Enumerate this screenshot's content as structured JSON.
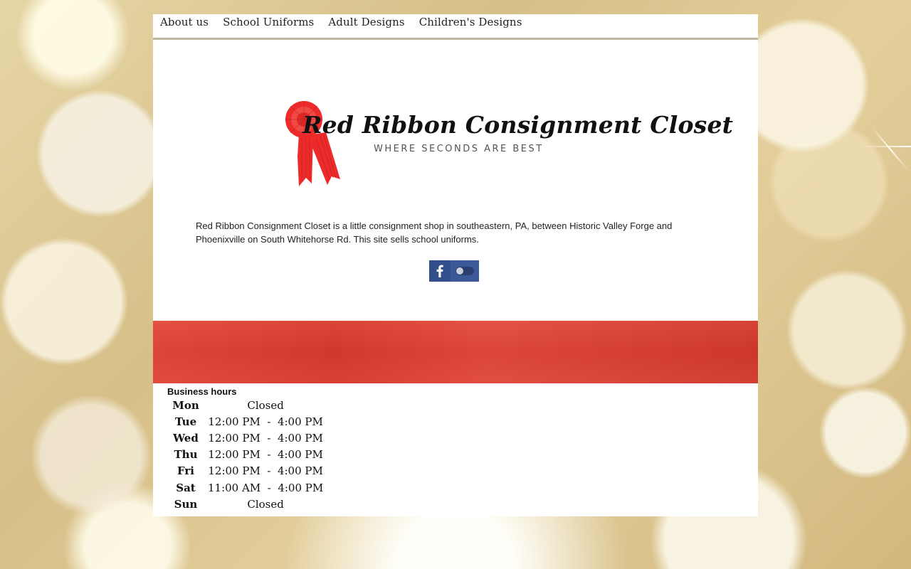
{
  "nav": {
    "items": [
      "About us",
      "School Uniforms",
      "Adult Designs",
      "Children's Designs"
    ]
  },
  "logo": {
    "title": "Red Ribbon Consignment Closet",
    "tagline": "WHERE SECONDS ARE BEST",
    "ribbon_color": "#ee2b2b"
  },
  "intro": {
    "text": "Red Ribbon Consignment Closet is a little consignment shop in southeastern, PA, between Historic Valley Forge and Phoenixville on South Whitehorse Rd. This site sells school uniforms."
  },
  "social": {
    "icon": "facebook-icon",
    "color": "#3b5998"
  },
  "banner": {
    "color": "#dc3d30"
  },
  "business_hours": {
    "title": "Business hours",
    "days": [
      {
        "day": "Mon",
        "hours": "Closed"
      },
      {
        "day": "Tue",
        "hours": "12:00 PM  -  4:00 PM"
      },
      {
        "day": "Wed",
        "hours": "12:00 PM  -  4:00 PM"
      },
      {
        "day": "Thu",
        "hours": "12:00 PM  -  4:00 PM"
      },
      {
        "day": "Fri",
        "hours": "12:00 PM  -  4:00 PM"
      },
      {
        "day": "Sat",
        "hours": "11:00 AM  -  4:00 PM"
      },
      {
        "day": "Sun",
        "hours": "Closed"
      }
    ]
  }
}
